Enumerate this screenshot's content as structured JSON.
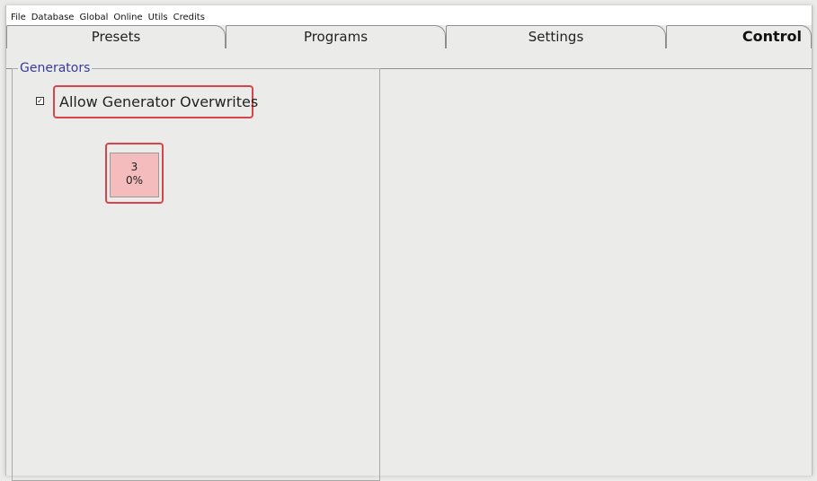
{
  "menu": [
    "File",
    "Database",
    "Global",
    "Online",
    "Utils",
    "Credits"
  ],
  "tabs": [
    {
      "label": "Presets",
      "active": false
    },
    {
      "label": "Programs",
      "active": false
    },
    {
      "label": "Settings",
      "active": false
    },
    {
      "label": "Control",
      "active": true
    }
  ],
  "generators": {
    "title": "Generators",
    "allow_overwrites": {
      "label": "Allow Generator Overwrites",
      "checked": true,
      "check_glyph": "✓"
    },
    "generator_button": {
      "number": "3",
      "percent": "0%",
      "color": "#f4bcbc"
    }
  },
  "colors": {
    "highlight": "#d9444a",
    "group_title": "#3a3a9a"
  }
}
